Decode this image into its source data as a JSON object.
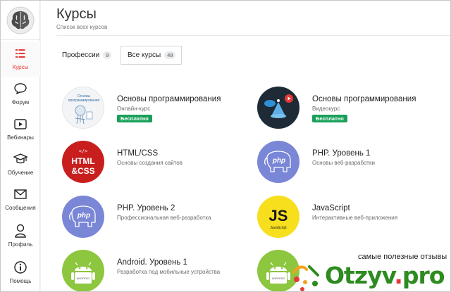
{
  "sidebar": {
    "items": [
      {
        "label": "Курсы",
        "icon": "list-icon",
        "active": true
      },
      {
        "label": "Форум",
        "icon": "chat-bubble-icon"
      },
      {
        "label": "Вебинары",
        "icon": "play-icon"
      },
      {
        "label": "Обучение",
        "icon": "graduation-cap-icon"
      },
      {
        "label": "Сообщения",
        "icon": "envelope-icon"
      },
      {
        "label": "Профиль",
        "icon": "user-icon"
      },
      {
        "label": "Помощь",
        "icon": "info-icon"
      }
    ]
  },
  "header": {
    "title": "Курсы",
    "subtitle": "Список всех курсов"
  },
  "tabs": [
    {
      "label": "Профессии",
      "count": "9"
    },
    {
      "label": "Все курсы",
      "count": "49",
      "active": true
    }
  ],
  "courses": [
    {
      "title": "Основы программирования",
      "subtitle": "Онлайн-курс",
      "badge": "Бесплатно",
      "thumb_text": "Основы программирования"
    },
    {
      "title": "Основы программирования",
      "subtitle": "Видеокурс",
      "badge": "Бесплатно"
    },
    {
      "title": "HTML/CSS",
      "subtitle": "Основы создания сайтов",
      "thumb_text": "HTML & CSS"
    },
    {
      "title": "PHP. Уровень 1",
      "subtitle": "Основы веб-разработки",
      "thumb_text": "php"
    },
    {
      "title": "PHP. Уровень 2",
      "subtitle": "Профессиональная веб-разработка",
      "thumb_text": "php"
    },
    {
      "title": "JavaScript",
      "subtitle": "Интерактивные веб-приложения",
      "thumb_text": "JS",
      "thumb_sub": "JavaScript"
    },
    {
      "title": "Android. Уровень 1",
      "subtitle": "Разработка под мобильные устройства",
      "thumb_text": "ANDROID"
    },
    {
      "title": "",
      "subtitle": "",
      "thumb_text": "ANDROID"
    }
  ],
  "watermark": {
    "caption": "самые полезные отзывы",
    "logo_main": "Otzyv",
    "logo_dot": ".",
    "logo_tld": "pro"
  },
  "colors": {
    "accent": "#e53935",
    "badge_green": "#1aa05a",
    "dark_thumb": "#1e2b36",
    "red_thumb": "#c81e1e",
    "php_purple": "#7a86d6",
    "js_yellow": "#f7df1e",
    "android_green": "#8dc63f"
  }
}
